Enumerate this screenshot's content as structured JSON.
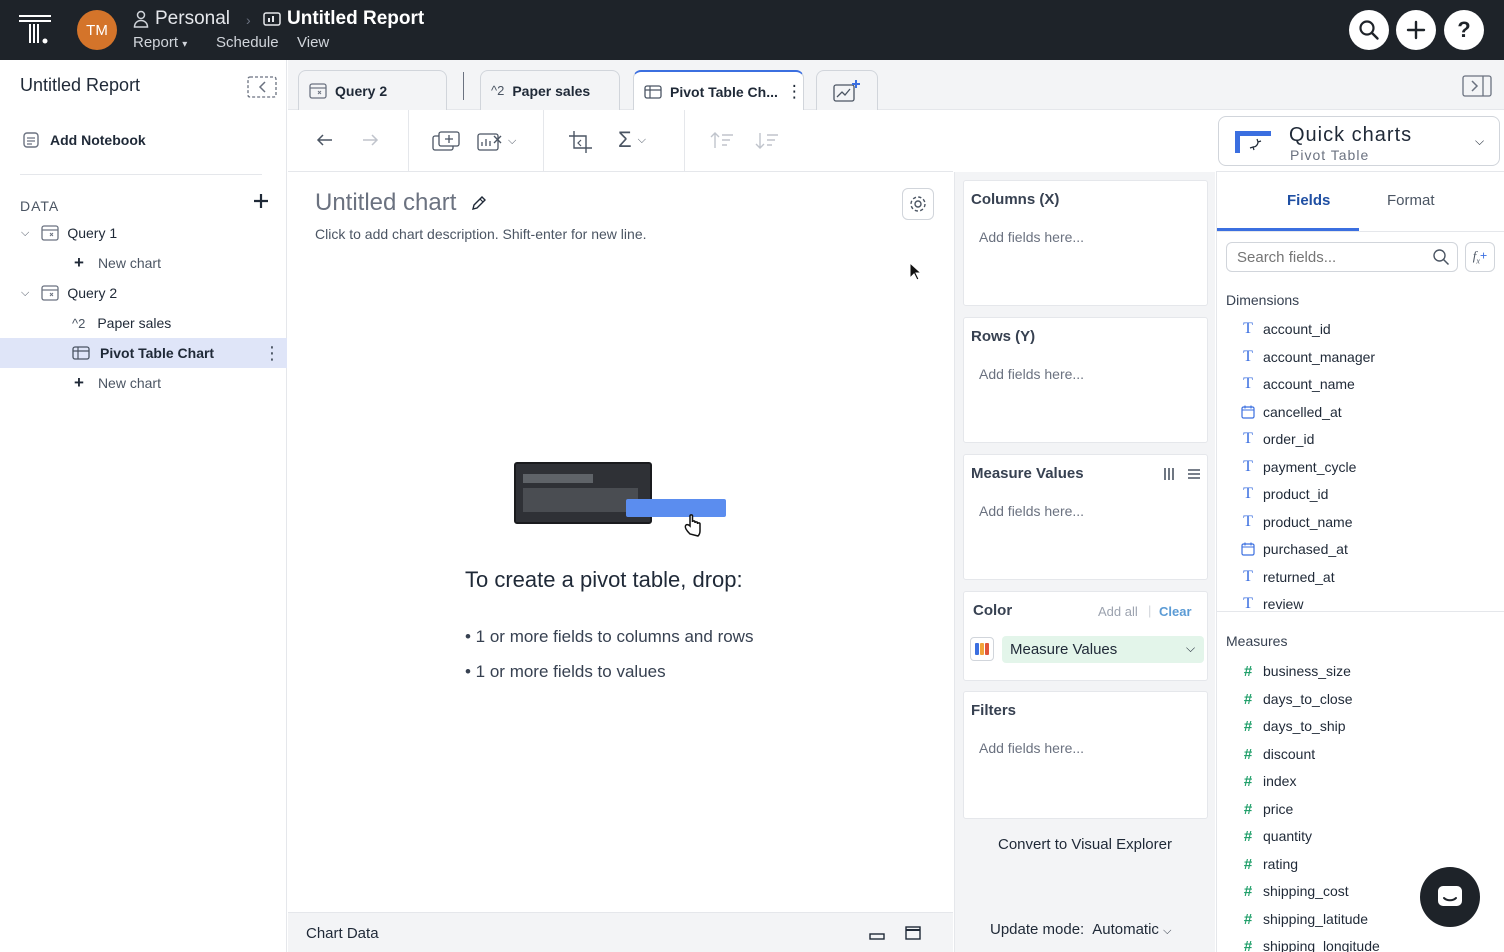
{
  "topbar": {
    "avatar": "TM",
    "crumb_space": "Personal",
    "crumb_report": "Untitled Report",
    "menu": [
      "Report",
      "Schedule",
      "View"
    ]
  },
  "sidebar": {
    "title": "Untitled Report",
    "add_notebook": "Add Notebook",
    "data_label": "DATA",
    "items": [
      {
        "label": "Query 1"
      },
      {
        "label": "New chart"
      },
      {
        "label": "Query 2"
      },
      {
        "label": "Paper sales"
      },
      {
        "label": "Pivot Table Chart"
      },
      {
        "label": "New chart"
      }
    ]
  },
  "tabs": [
    {
      "label": "Query 2"
    },
    {
      "label": "Paper sales"
    },
    {
      "label": "Pivot Table Ch..."
    }
  ],
  "quick_charts": {
    "title": "Quick charts",
    "subtitle": "Pivot Table"
  },
  "canvas": {
    "chart_title": "Untitled chart",
    "description": "Click to add chart description. Shift-enter for new line.",
    "heading": "To create a pivot table, drop:",
    "bullet1": "• 1 or more fields to columns and rows",
    "bullet2": "• 1 or more fields to values"
  },
  "chart_data_label": "Chart Data",
  "config": {
    "columns": "Columns (X)",
    "rows": "Rows (Y)",
    "measure_values": "Measure Values",
    "color": "Color",
    "add_all": "Add all",
    "clear": "Clear",
    "color_field": "Measure Values",
    "filters": "Filters",
    "placeholder": "Add fields here...",
    "convert": "Convert to Visual Explorer",
    "update_mode_label": "Update mode:",
    "update_mode_value": "Automatic"
  },
  "fields_panel": {
    "tab_fields": "Fields",
    "tab_format": "Format",
    "search_placeholder": "Search fields...",
    "dimensions_label": "Dimensions",
    "dimensions": [
      {
        "name": "account_id",
        "type": "text"
      },
      {
        "name": "account_manager",
        "type": "text"
      },
      {
        "name": "account_name",
        "type": "text"
      },
      {
        "name": "cancelled_at",
        "type": "date"
      },
      {
        "name": "order_id",
        "type": "text"
      },
      {
        "name": "payment_cycle",
        "type": "text"
      },
      {
        "name": "product_id",
        "type": "text"
      },
      {
        "name": "product_name",
        "type": "text"
      },
      {
        "name": "purchased_at",
        "type": "date"
      },
      {
        "name": "returned_at",
        "type": "text"
      },
      {
        "name": "review",
        "type": "text"
      }
    ],
    "measures_label": "Measures",
    "measures": [
      "business_size",
      "days_to_close",
      "days_to_ship",
      "discount",
      "index",
      "price",
      "quantity",
      "rating",
      "shipping_cost",
      "shipping_latitude",
      "shipping_longitude"
    ]
  },
  "colors": {
    "topbar": "#1e2329",
    "accent": "#3b6fe0",
    "avatar": "#d4742a",
    "selected_row": "#dfe5f8",
    "measure_green": "#22a06b"
  }
}
